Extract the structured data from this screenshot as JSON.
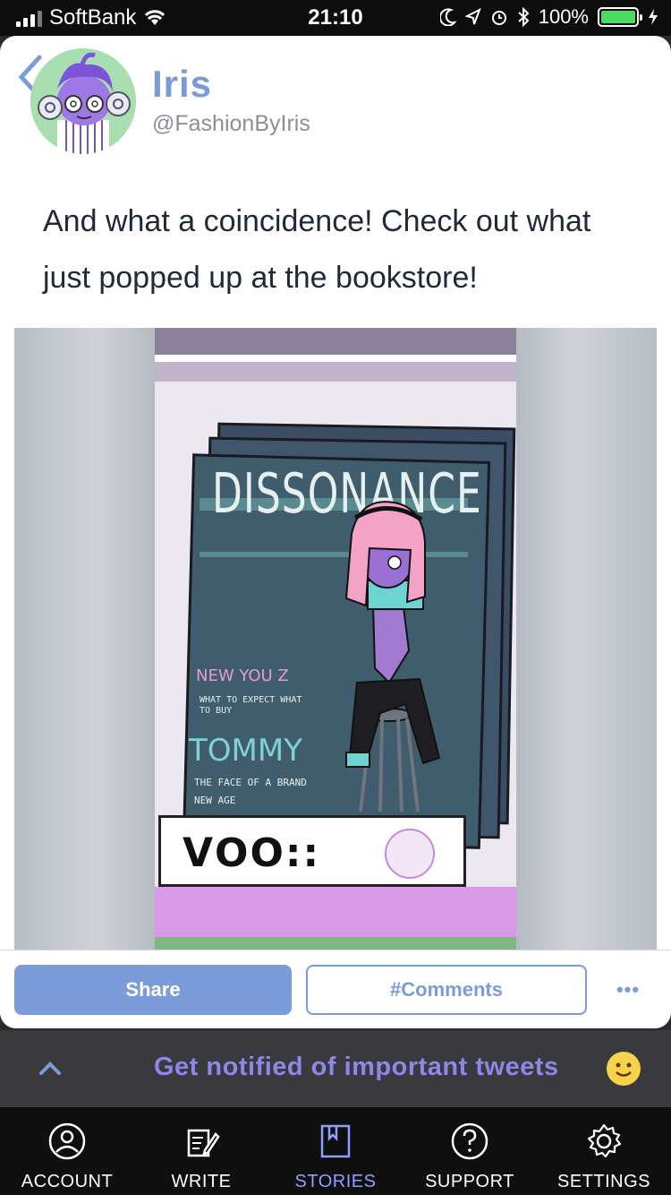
{
  "status_bar": {
    "carrier": "SoftBank",
    "time": "21:10",
    "battery": "100%"
  },
  "post": {
    "author_name": "Iris",
    "author_handle": "@FashionByIris",
    "text": "And what a coincidence! Check out what just popped up at the bookstore!",
    "image": {
      "magazine_title": "DISSONANCE",
      "line_new_you": "NEW YOU Z",
      "line_what_to": "WHAT TO EXPECT WHAT TO BUY",
      "line_tommy": "TOMMY",
      "line_face": "THE FACE OF A BRAND NEW AGE"
    }
  },
  "actions": {
    "share_label": "Share",
    "comments_label": "#Comments",
    "more_label": "•••"
  },
  "notify_bar": {
    "text": "Get notified of important tweets"
  },
  "tabs": [
    {
      "label": "ACCOUNT",
      "icon": "account-icon"
    },
    {
      "label": "WRITE",
      "icon": "write-icon"
    },
    {
      "label": "STORIES",
      "icon": "stories-icon"
    },
    {
      "label": "SUPPORT",
      "icon": "support-icon"
    },
    {
      "label": "SETTINGS",
      "icon": "settings-icon"
    }
  ],
  "colors": {
    "accent": "#7b9cd8",
    "active_tab": "#8ba0ff",
    "notify_text": "#8e86e8"
  }
}
